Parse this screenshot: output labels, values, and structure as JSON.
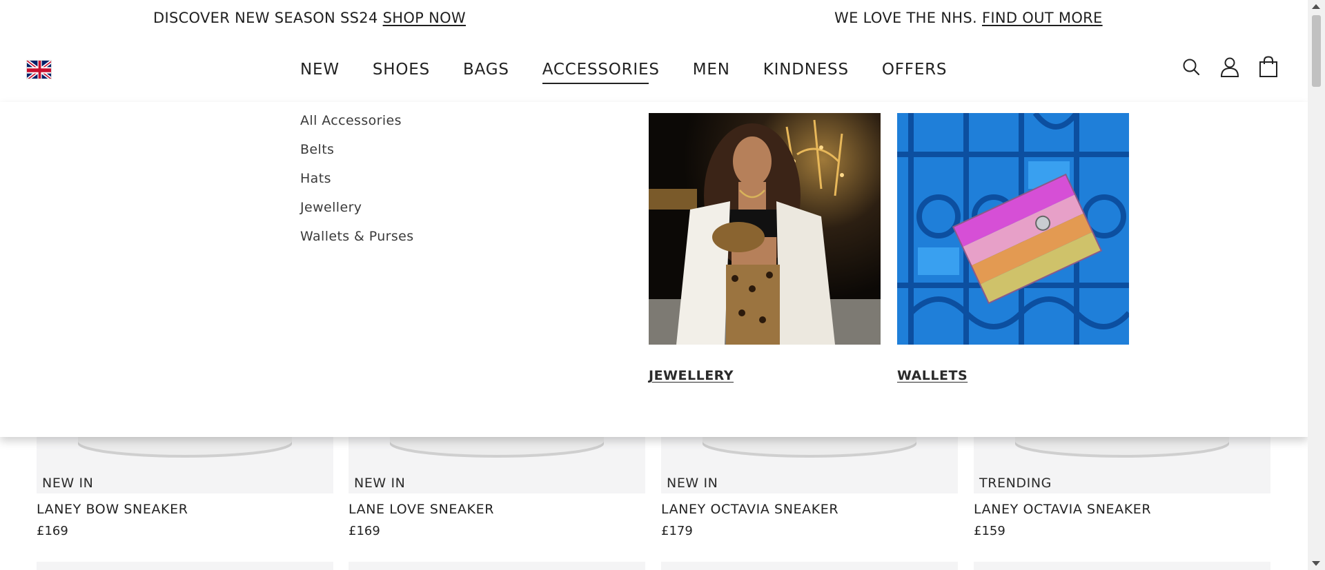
{
  "promo_bar": {
    "left_text": "DISCOVER NEW SEASON SS24",
    "left_link": "SHOP NOW",
    "right_text": "WE LOVE THE NHS.",
    "right_link": "FIND OUT MORE"
  },
  "header": {
    "nav": [
      {
        "label": "NEW"
      },
      {
        "label": "SHOES"
      },
      {
        "label": "BAGS"
      },
      {
        "label": "ACCESSORIES",
        "active": true
      },
      {
        "label": "MEN"
      },
      {
        "label": "KINDNESS"
      },
      {
        "label": "OFFERS"
      }
    ],
    "icons": [
      "search-icon",
      "account-icon",
      "bag-icon"
    ],
    "flag_icon": "uk-flag-icon"
  },
  "mega_menu": {
    "links": [
      "All Accessories",
      "Belts",
      "Hats",
      "Jewellery",
      "Wallets & Purses"
    ],
    "tiles": [
      {
        "caption": "JEWELLERY"
      },
      {
        "caption": "WALLETS"
      }
    ]
  },
  "products": [
    {
      "badge": "NEW IN",
      "name": "LANEY BOW SNEAKER",
      "price": "£169"
    },
    {
      "badge": "NEW IN",
      "name": "LANE LOVE SNEAKER",
      "price": "£169"
    },
    {
      "badge": "NEW IN",
      "name": "LANEY OCTAVIA SNEAKER",
      "price": "£179"
    },
    {
      "badge": "TRENDING",
      "name": "LANEY OCTAVIA SNEAKER",
      "price": "£159"
    }
  ]
}
